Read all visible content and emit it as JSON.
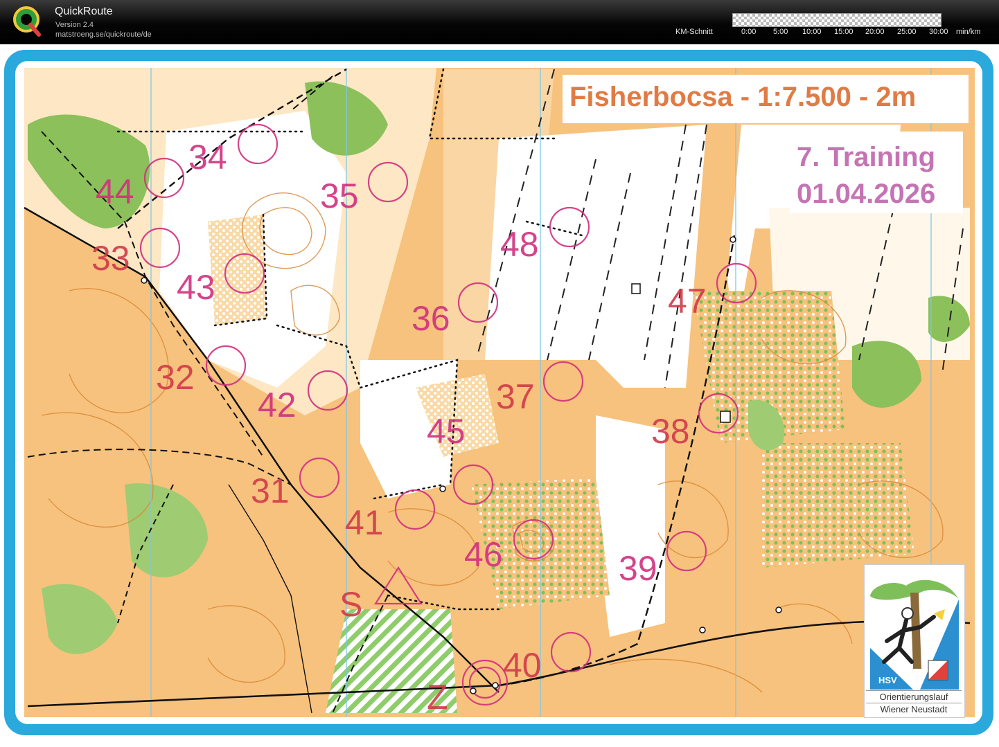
{
  "app": {
    "title": "QuickRoute",
    "version": "Version 2.4",
    "url": "matstroeng.se/quickroute/de"
  },
  "pace_scale": {
    "label": "KM-Schnitt",
    "ticks": [
      "0:00",
      "5:00",
      "10:00",
      "15:00",
      "20:00",
      "25:00",
      "30:00",
      "min/km"
    ]
  },
  "map": {
    "title": "Fisherbocsa - 1:7.500 - 2m",
    "event_title": "7. Training",
    "event_date": "01.04.2026",
    "controls": [
      {
        "label": "44"
      },
      {
        "label": "34"
      },
      {
        "label": "35"
      },
      {
        "label": "33"
      },
      {
        "label": "43"
      },
      {
        "label": "48"
      },
      {
        "label": "36"
      },
      {
        "label": "47"
      },
      {
        "label": "32"
      },
      {
        "label": "42"
      },
      {
        "label": "37"
      },
      {
        "label": "45"
      },
      {
        "label": "38"
      },
      {
        "label": "31"
      },
      {
        "label": "41"
      },
      {
        "label": "46"
      },
      {
        "label": "39"
      },
      {
        "label": "S"
      },
      {
        "label": "40"
      },
      {
        "label": "Z"
      }
    ],
    "club_logo": {
      "short": "HSV",
      "line1": "Orientierungslauf",
      "line2": "Wiener Neustadt"
    },
    "colors": {
      "frame": "#29a9dc",
      "terrain_open": "#f7c27d",
      "vegetation": "#8cc05a",
      "course": "#d0307f",
      "contour": "#d98a3a"
    }
  }
}
